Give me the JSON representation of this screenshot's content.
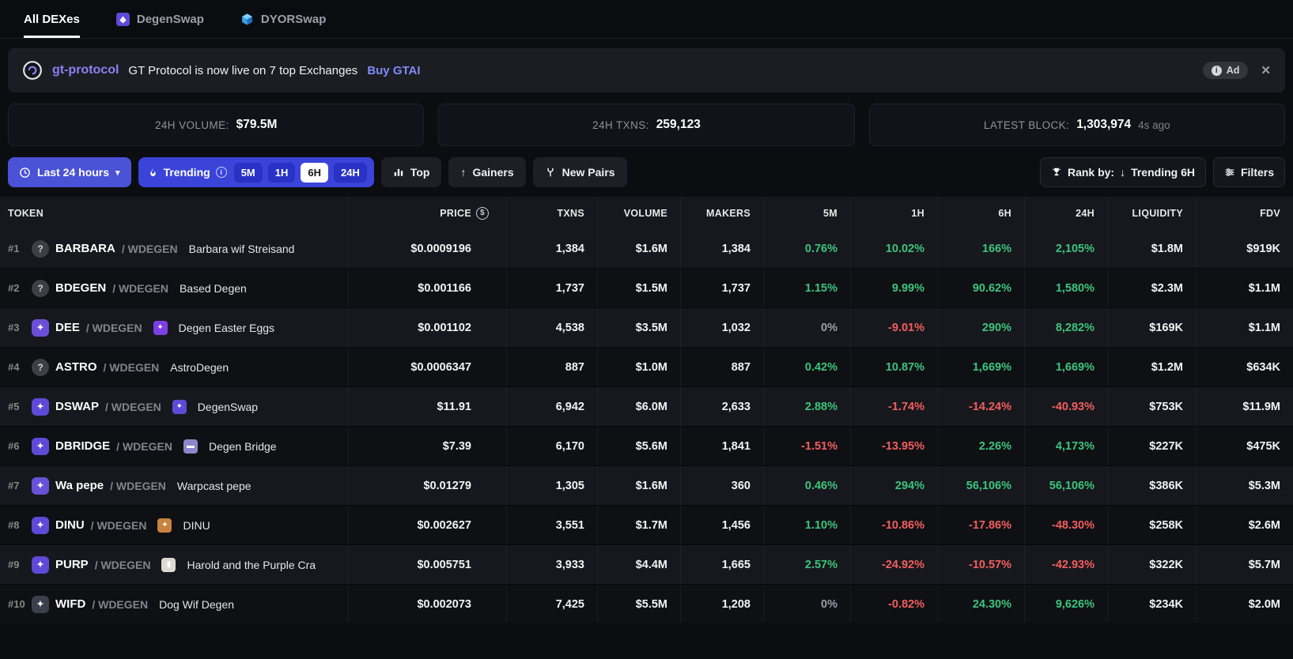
{
  "colors": {
    "green": "#3cc47c",
    "red": "#f25e5e",
    "neutral_gray": "#9aa0a8",
    "trending_blue": "#3a44d8",
    "time_button_indigo": "#4a52d5",
    "brand_purple": "#8f7ff5",
    "link_blue": "#7d8cf8"
  },
  "icons": {
    "question": "?",
    "dollar": "$",
    "info": "i",
    "close": "✕",
    "caret_down": "▾",
    "gainers_arrow": "↑",
    "sort_arrow": "↓"
  },
  "tabs": [
    {
      "label": "All DEXes",
      "active": true
    },
    {
      "label": "DegenSwap",
      "active": false
    },
    {
      "label": "DYORSwap",
      "active": false
    }
  ],
  "ad_banner": {
    "brand": "gt-protocol",
    "message": "GT Protocol is now live on 7 top Exchanges",
    "cta": "Buy GTAI",
    "badge": "Ad"
  },
  "stats": [
    {
      "label": "24H VOLUME:",
      "value": "$79.5M"
    },
    {
      "label": "24H TXNS:",
      "value": "259,123"
    },
    {
      "label": "LATEST BLOCK:",
      "value": "1,303,974",
      "suffix": "4s ago"
    }
  ],
  "toolbar": {
    "time_range": "Last 24 hours",
    "trending": "Trending",
    "trending_options": [
      "5M",
      "1H",
      "6H",
      "24H"
    ],
    "trending_active": "6H",
    "top": "Top",
    "gainers": "Gainers",
    "new_pairs": "New Pairs",
    "rank_by_label": "Rank by:",
    "rank_by_value": "Trending 6H",
    "filters": "Filters"
  },
  "table": {
    "headers": [
      "TOKEN",
      "PRICE",
      "TXNS",
      "VOLUME",
      "MAKERS",
      "5M",
      "1H",
      "6H",
      "24H",
      "LIQUIDITY",
      "FDV"
    ],
    "rows": [
      {
        "rank": "#1",
        "icon": {
          "kind": "question"
        },
        "base": "BARBARA",
        "quote": "WDEGEN",
        "name": "Barbara wif Streisand",
        "name_icon": null,
        "price": "$0.0009196",
        "txns": "1,384",
        "volume": "$1.6M",
        "makers": "1,384",
        "changes": [
          {
            "value": "0.76%",
            "dir": "up"
          },
          {
            "value": "10.02%",
            "dir": "up"
          },
          {
            "value": "166%",
            "dir": "up"
          },
          {
            "value": "2,105%",
            "dir": "up"
          }
        ],
        "liquidity": "$1.8M",
        "fdv": "$919K"
      },
      {
        "rank": "#2",
        "icon": {
          "kind": "question"
        },
        "base": "BDEGEN",
        "quote": "WDEGEN",
        "name": "Based Degen",
        "name_icon": null,
        "price": "$0.001166",
        "txns": "1,737",
        "volume": "$1.5M",
        "makers": "1,737",
        "changes": [
          {
            "value": "1.15%",
            "dir": "up"
          },
          {
            "value": "9.99%",
            "dir": "up"
          },
          {
            "value": "90.62%",
            "dir": "up"
          },
          {
            "value": "1,580%",
            "dir": "up"
          }
        ],
        "liquidity": "$2.3M",
        "fdv": "$1.1M"
      },
      {
        "rank": "#3",
        "icon": {
          "kind": "logo",
          "bg": "#6c4fd8",
          "glyph": "✦"
        },
        "base": "DEE",
        "quote": "WDEGEN",
        "name": "Degen Easter Eggs",
        "name_icon": {
          "bg": "#7b3fe4",
          "glyph": "✦"
        },
        "price": "$0.001102",
        "txns": "4,538",
        "volume": "$3.5M",
        "makers": "1,032",
        "changes": [
          {
            "value": "0%",
            "dir": "neutral"
          },
          {
            "value": "-9.01%",
            "dir": "down"
          },
          {
            "value": "290%",
            "dir": "up"
          },
          {
            "value": "8,282%",
            "dir": "up"
          }
        ],
        "liquidity": "$169K",
        "fdv": "$1.1M"
      },
      {
        "rank": "#4",
        "icon": {
          "kind": "question"
        },
        "base": "ASTRO",
        "quote": "WDEGEN",
        "name": "AstroDegen",
        "name_icon": null,
        "price": "$0.0006347",
        "txns": "887",
        "volume": "$1.0M",
        "makers": "887",
        "changes": [
          {
            "value": "0.42%",
            "dir": "up"
          },
          {
            "value": "10.87%",
            "dir": "up"
          },
          {
            "value": "1,669%",
            "dir": "up"
          },
          {
            "value": "1,669%",
            "dir": "up"
          }
        ],
        "liquidity": "$1.2M",
        "fdv": "$634K"
      },
      {
        "rank": "#5",
        "icon": {
          "kind": "logo",
          "bg": "#5f49d6",
          "glyph": "✦"
        },
        "base": "DSWAP",
        "quote": "WDEGEN",
        "name": "DegenSwap",
        "name_icon": {
          "bg": "#5f49d6",
          "glyph": "✦"
        },
        "price": "$11.91",
        "txns": "6,942",
        "volume": "$6.0M",
        "makers": "2,633",
        "changes": [
          {
            "value": "2.88%",
            "dir": "up"
          },
          {
            "value": "-1.74%",
            "dir": "down"
          },
          {
            "value": "-14.24%",
            "dir": "down"
          },
          {
            "value": "-40.93%",
            "dir": "down"
          }
        ],
        "liquidity": "$753K",
        "fdv": "$11.9M"
      },
      {
        "rank": "#6",
        "icon": {
          "kind": "logo",
          "bg": "#5f49d6",
          "glyph": "✦"
        },
        "base": "DBRIDGE",
        "quote": "WDEGEN",
        "name": "Degen Bridge",
        "name_icon": {
          "bg": "#8d86c9",
          "glyph": "▬"
        },
        "price": "$7.39",
        "txns": "6,170",
        "volume": "$5.6M",
        "makers": "1,841",
        "changes": [
          {
            "value": "-1.51%",
            "dir": "down"
          },
          {
            "value": "-13.95%",
            "dir": "down"
          },
          {
            "value": "2.26%",
            "dir": "up"
          },
          {
            "value": "4,173%",
            "dir": "up"
          }
        ],
        "liquidity": "$227K",
        "fdv": "$475K"
      },
      {
        "rank": "#7",
        "icon": {
          "kind": "logo",
          "bg": "#6752d8",
          "glyph": "✦"
        },
        "base": "Wa pepe",
        "quote": "WDEGEN",
        "name": "Warpcast pepe",
        "name_icon": null,
        "price": "$0.01279",
        "txns": "1,305",
        "volume": "$1.6M",
        "makers": "360",
        "changes": [
          {
            "value": "0.46%",
            "dir": "up"
          },
          {
            "value": "294%",
            "dir": "up"
          },
          {
            "value": "56,106%",
            "dir": "up"
          },
          {
            "value": "56,106%",
            "dir": "up"
          }
        ],
        "liquidity": "$386K",
        "fdv": "$5.3M"
      },
      {
        "rank": "#8",
        "icon": {
          "kind": "logo",
          "bg": "#5f49d6",
          "glyph": "✦"
        },
        "base": "DINU",
        "quote": "WDEGEN",
        "name": "DINU",
        "name_icon": {
          "bg": "#c8833f",
          "glyph": "✦"
        },
        "price": "$0.002627",
        "txns": "3,551",
        "volume": "$1.7M",
        "makers": "1,456",
        "changes": [
          {
            "value": "1.10%",
            "dir": "up"
          },
          {
            "value": "-10.86%",
            "dir": "down"
          },
          {
            "value": "-17.86%",
            "dir": "down"
          },
          {
            "value": "-48.30%",
            "dir": "down"
          }
        ],
        "liquidity": "$258K",
        "fdv": "$2.6M"
      },
      {
        "rank": "#9",
        "icon": {
          "kind": "logo",
          "bg": "#5f49d6",
          "glyph": "✦"
        },
        "base": "PURP",
        "quote": "WDEGEN",
        "name": "Harold and the Purple Cra",
        "name_icon": {
          "bg": "#ded9cf",
          "glyph": "▮"
        },
        "price": "$0.005751",
        "txns": "3,933",
        "volume": "$4.4M",
        "makers": "1,665",
        "changes": [
          {
            "value": "2.57%",
            "dir": "up"
          },
          {
            "value": "-24.92%",
            "dir": "down"
          },
          {
            "value": "-10.57%",
            "dir": "down"
          },
          {
            "value": "-42.93%",
            "dir": "down"
          }
        ],
        "liquidity": "$322K",
        "fdv": "$5.7M"
      },
      {
        "rank": "#10",
        "icon": {
          "kind": "logo",
          "bg": "#3a3f4b",
          "glyph": "✦"
        },
        "base": "WIFD",
        "quote": "WDEGEN",
        "name": "Dog Wif Degen",
        "name_icon": null,
        "price": "$0.002073",
        "txns": "7,425",
        "volume": "$5.5M",
        "makers": "1,208",
        "changes": [
          {
            "value": "0%",
            "dir": "neutral"
          },
          {
            "value": "-0.82%",
            "dir": "down"
          },
          {
            "value": "24.30%",
            "dir": "up"
          },
          {
            "value": "9,626%",
            "dir": "up"
          }
        ],
        "liquidity": "$234K",
        "fdv": "$2.0M"
      }
    ]
  }
}
